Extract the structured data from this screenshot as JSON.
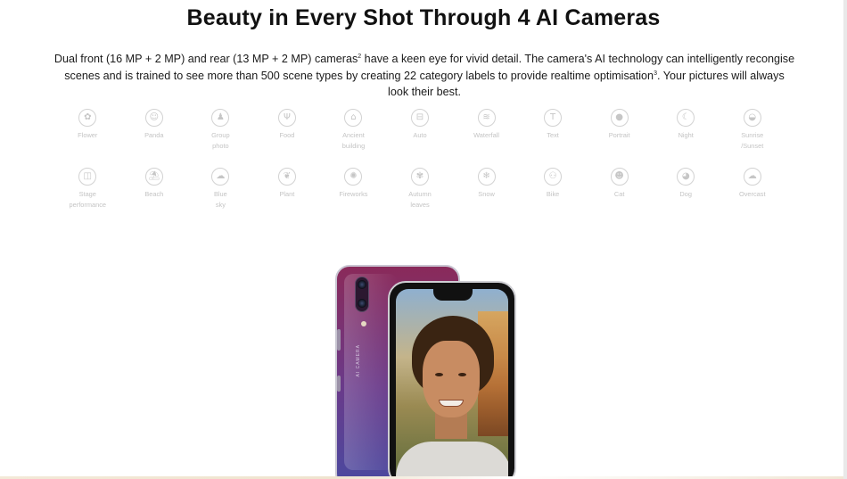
{
  "heading": "Beauty in Every Shot Through 4 AI Cameras",
  "description": {
    "part1": "Dual front (16 MP + 2 MP) and rear (13 MP + 2 MP) cameras",
    "sup1": "2",
    "part2": " have a keen eye for vivid detail. The camera's AI technology can intelligently recongise scenes and is trained to see more than 500 scene types by creating 22 category labels to provide realtime optimisation",
    "sup2": "3",
    "part3": ". Your pictures will always look their best."
  },
  "scenes_row1": [
    {
      "label": "Flower",
      "icon": "flower-icon",
      "glyph": "✿"
    },
    {
      "label": "Panda",
      "icon": "panda-icon",
      "glyph": "☺"
    },
    {
      "label": "Group\nphoto",
      "icon": "group-photo-icon",
      "glyph": "♟"
    },
    {
      "label": "Food",
      "icon": "food-icon",
      "glyph": "Ψ"
    },
    {
      "label": "Ancient\nbuilding",
      "icon": "ancient-building-icon",
      "glyph": "⌂"
    },
    {
      "label": "Auto",
      "icon": "auto-icon",
      "glyph": "⊟"
    },
    {
      "label": "Waterfall",
      "icon": "waterfall-icon",
      "glyph": "≋"
    },
    {
      "label": "Text",
      "icon": "text-icon",
      "glyph": "T"
    },
    {
      "label": "Portrait",
      "icon": "portrait-icon",
      "glyph": "●"
    },
    {
      "label": "Night",
      "icon": "night-icon",
      "glyph": "☾"
    },
    {
      "label": "Sunrise\n/Sunset",
      "icon": "sunrise-sunset-icon",
      "glyph": "◒"
    }
  ],
  "scenes_row2": [
    {
      "label": "Stage\nperformance",
      "icon": "stage-performance-icon",
      "glyph": "◫"
    },
    {
      "label": "Beach",
      "icon": "beach-icon",
      "glyph": "⛱"
    },
    {
      "label": "Blue\nsky",
      "icon": "blue-sky-icon",
      "glyph": "☁"
    },
    {
      "label": "Plant",
      "icon": "plant-icon",
      "glyph": "❦"
    },
    {
      "label": "Fireworks",
      "icon": "fireworks-icon",
      "glyph": "✺"
    },
    {
      "label": "Autumn\nleaves",
      "icon": "autumn-leaves-icon",
      "glyph": "✾"
    },
    {
      "label": "Snow",
      "icon": "snow-icon",
      "glyph": "❄"
    },
    {
      "label": "Bike",
      "icon": "bike-icon",
      "glyph": "⚇"
    },
    {
      "label": "Cat",
      "icon": "cat-icon",
      "glyph": "☻"
    },
    {
      "label": "Dog",
      "icon": "dog-icon",
      "glyph": "◕"
    },
    {
      "label": "Overcast",
      "icon": "overcast-icon",
      "glyph": "☁"
    }
  ],
  "phone": {
    "back_label": "AI CAMERA"
  }
}
